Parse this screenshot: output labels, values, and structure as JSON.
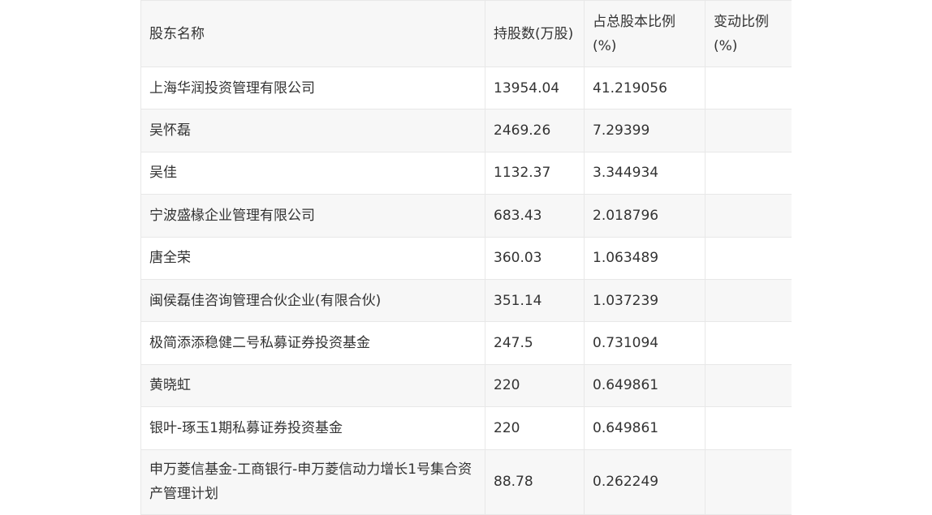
{
  "table": {
    "headers": [
      "股东名称",
      "持股数(万股)",
      "占总股本比例(%)",
      "变动比例(%)"
    ],
    "rows": [
      {
        "name": "上海华润投资管理有限公司",
        "shares": "13954.04",
        "ratio": "41.219056",
        "change": ""
      },
      {
        "name": "吴怀磊",
        "shares": "2469.26",
        "ratio": "7.29399",
        "change": ""
      },
      {
        "name": "吴佳",
        "shares": "1132.37",
        "ratio": "3.344934",
        "change": ""
      },
      {
        "name": "宁波盛椽企业管理有限公司",
        "shares": "683.43",
        "ratio": "2.018796",
        "change": ""
      },
      {
        "name": "唐全荣",
        "shares": "360.03",
        "ratio": "1.063489",
        "change": ""
      },
      {
        "name": "闽侯磊佳咨询管理合伙企业(有限合伙)",
        "shares": "351.14",
        "ratio": "1.037239",
        "change": ""
      },
      {
        "name": "极简添添稳健二号私募证券投资基金",
        "shares": "247.5",
        "ratio": "0.731094",
        "change": ""
      },
      {
        "name": "黄晓虹",
        "shares": "220",
        "ratio": "0.649861",
        "change": ""
      },
      {
        "name": "银叶-琢玉1期私募证券投资基金",
        "shares": "220",
        "ratio": "0.649861",
        "change": ""
      },
      {
        "name": "申万菱信基金-工商银行-申万菱信动力增长1号集合资产管理计划",
        "shares": "88.78",
        "ratio": "0.262249",
        "change": ""
      }
    ]
  }
}
